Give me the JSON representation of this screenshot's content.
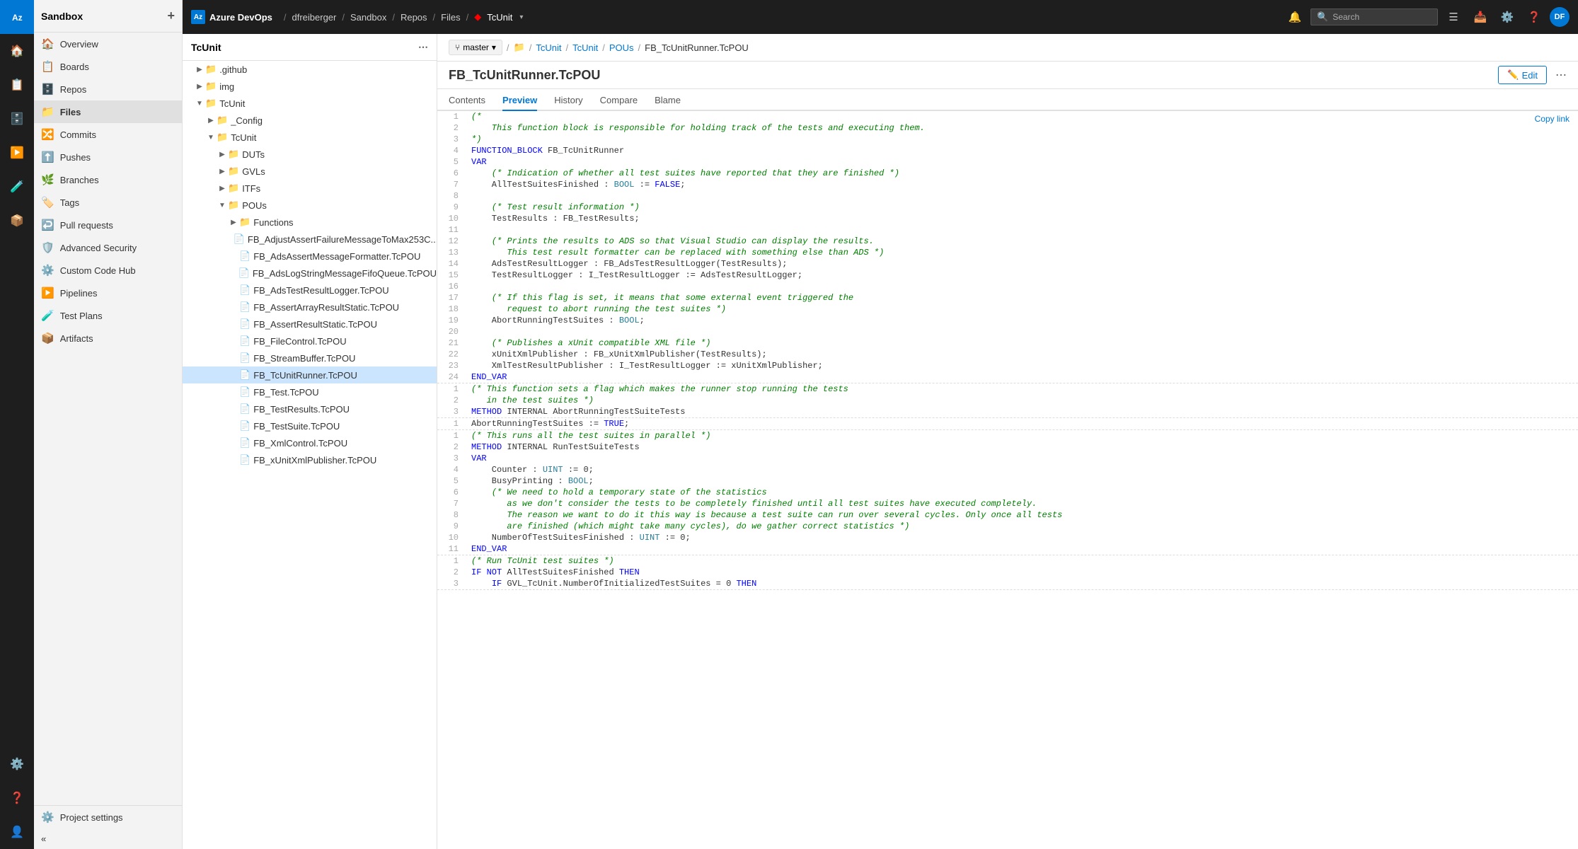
{
  "app": {
    "name": "Azure DevOps",
    "logo_text": "AZ"
  },
  "topbar": {
    "breadcrumbs": [
      "dfreiberger",
      "Sandbox",
      "Repos",
      "Files",
      "TcUnit"
    ],
    "search_placeholder": "Search",
    "user_initials": "DF"
  },
  "sidebar": {
    "project": "Sandbox",
    "items": [
      {
        "label": "Overview",
        "icon": "🏠"
      },
      {
        "label": "Boards",
        "icon": "📋"
      },
      {
        "label": "Repos",
        "icon": "🗄️"
      },
      {
        "label": "Files",
        "icon": "📁"
      },
      {
        "label": "Commits",
        "icon": "🔀"
      },
      {
        "label": "Pushes",
        "icon": "⬆️"
      },
      {
        "label": "Branches",
        "icon": "🌿"
      },
      {
        "label": "Tags",
        "icon": "🏷️"
      },
      {
        "label": "Pull requests",
        "icon": "↩️"
      },
      {
        "label": "Advanced Security",
        "icon": "🛡️"
      },
      {
        "label": "Custom Code Hub",
        "icon": "⚙️"
      },
      {
        "label": "Pipelines",
        "icon": "▶️"
      },
      {
        "label": "Test Plans",
        "icon": "🧪"
      },
      {
        "label": "Artifacts",
        "icon": "📦"
      }
    ],
    "footer": {
      "label": "Project settings",
      "icon": "⚙️"
    }
  },
  "filetree": {
    "repo_name": "TcUnit",
    "items": [
      {
        "indent": 1,
        "type": "folder",
        "name": ".github",
        "expanded": false
      },
      {
        "indent": 1,
        "type": "folder",
        "name": "img",
        "expanded": false
      },
      {
        "indent": 1,
        "type": "folder",
        "name": "TcUnit",
        "expanded": true
      },
      {
        "indent": 2,
        "type": "folder",
        "name": "_Config",
        "expanded": false
      },
      {
        "indent": 2,
        "type": "folder",
        "name": "TcUnit",
        "expanded": true
      },
      {
        "indent": 3,
        "type": "folder",
        "name": "DUTs",
        "expanded": false
      },
      {
        "indent": 3,
        "type": "folder",
        "name": "GVLs",
        "expanded": false
      },
      {
        "indent": 3,
        "type": "folder",
        "name": "ITFs",
        "expanded": false
      },
      {
        "indent": 3,
        "type": "folder",
        "name": "POUs",
        "expanded": true
      },
      {
        "indent": 4,
        "type": "folder",
        "name": "Functions",
        "expanded": false
      },
      {
        "indent": 4,
        "type": "file",
        "name": "FB_AdjustAssertFailureMessageToMax253C...",
        "selected": false
      },
      {
        "indent": 4,
        "type": "file",
        "name": "FB_AdsAssertMessageFormatter.TcPOU",
        "selected": false
      },
      {
        "indent": 4,
        "type": "file",
        "name": "FB_AdsLogStringMessageFifoQueue.TcPOU",
        "selected": false
      },
      {
        "indent": 4,
        "type": "file",
        "name": "FB_AdsTestResultLogger.TcPOU",
        "selected": false
      },
      {
        "indent": 4,
        "type": "file",
        "name": "FB_AssertArrayResultStatic.TcPOU",
        "selected": false
      },
      {
        "indent": 4,
        "type": "file",
        "name": "FB_AssertResultStatic.TcPOU",
        "selected": false
      },
      {
        "indent": 4,
        "type": "file",
        "name": "FB_FileControl.TcPOU",
        "selected": false
      },
      {
        "indent": 4,
        "type": "file",
        "name": "FB_StreamBuffer.TcPOU",
        "selected": false
      },
      {
        "indent": 4,
        "type": "file",
        "name": "FB_TcUnitRunner.TcPOU",
        "selected": true
      },
      {
        "indent": 4,
        "type": "file",
        "name": "FB_Test.TcPOU",
        "selected": false
      },
      {
        "indent": 4,
        "type": "file",
        "name": "FB_TestResults.TcPOU",
        "selected": false
      },
      {
        "indent": 4,
        "type": "file",
        "name": "FB_TestSuite.TcPOU",
        "selected": false
      },
      {
        "indent": 4,
        "type": "file",
        "name": "FB_XmlControl.TcPOU",
        "selected": false
      },
      {
        "indent": 4,
        "type": "file",
        "name": "FB_xUnitXmlPublisher.TcPOU",
        "selected": false
      }
    ]
  },
  "editor": {
    "branch": "master",
    "breadcrumbs": [
      "TcUnit",
      "TcUnit",
      "POUs",
      "FB_TcUnitRunner.TcPOU"
    ],
    "filename": "FB_TcUnitRunner.TcPOU",
    "tabs": [
      "Contents",
      "Preview",
      "History",
      "Compare",
      "Blame"
    ],
    "active_tab": "Preview",
    "copy_link_label": "Copy link",
    "edit_button_label": "Edit"
  }
}
